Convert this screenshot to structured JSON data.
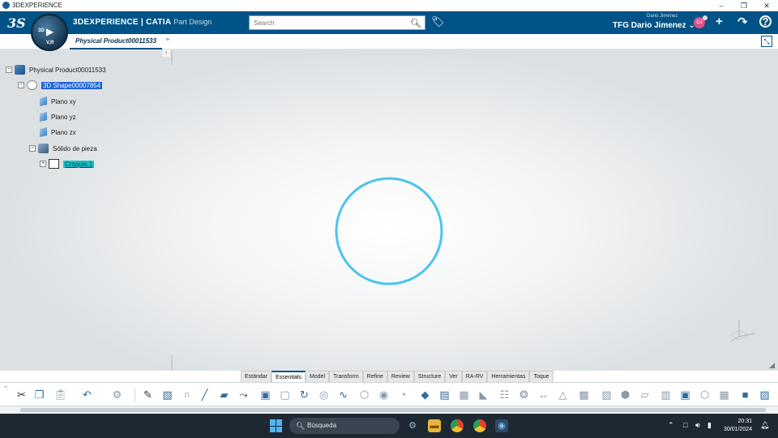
{
  "window": {
    "title": "3DEXPERIENCE",
    "minimize": "–",
    "restore": "❐",
    "close": "✕"
  },
  "header": {
    "logo": "3S",
    "compass": {
      "label_3d": "3D",
      "label_v": "V,R",
      "play": "▶"
    },
    "brand_main": "3DEXPERIENCE | CATIA",
    "brand_app": "Part Design",
    "search_placeholder": "Search",
    "user_small": "Dario Jiménez",
    "user_name": "TFG Dario Jimenez",
    "avatar_initials": "DJ"
  },
  "tabs": {
    "active_tab": "Physical Product00011533",
    "add": "+"
  },
  "tree": [
    {
      "label": "Physical Product00011533",
      "expander": "−",
      "icon": "product-icon",
      "level": 0,
      "highlight": "none"
    },
    {
      "label": "3D Shape00007854",
      "expander": "−",
      "icon": "shape-icon",
      "level": 1,
      "highlight": "blue"
    },
    {
      "label": "Plano xy",
      "expander": "",
      "icon": "plane-icon",
      "level": 2,
      "highlight": "none"
    },
    {
      "label": "Plano yz",
      "expander": "",
      "icon": "plane-icon",
      "level": 2,
      "highlight": "none"
    },
    {
      "label": "Plano zx",
      "expander": "",
      "icon": "plane-icon",
      "level": 2,
      "highlight": "none"
    },
    {
      "label": "Sólido de pieza",
      "expander": "−",
      "icon": "solid-icon",
      "level": 2,
      "highlight": "none"
    },
    {
      "label": "Croquis.1",
      "expander": "+",
      "icon": "sketch-icon",
      "level": 3,
      "highlight": "cyan"
    }
  ],
  "sketch": {
    "color": "#4cc4ec"
  },
  "workbench_tabs": [
    {
      "label": "Estándar",
      "active": false
    },
    {
      "label": "Essentials",
      "active": true
    },
    {
      "label": "Model",
      "active": false
    },
    {
      "label": "Transform",
      "active": false
    },
    {
      "label": "Refine",
      "active": false
    },
    {
      "label": "Review",
      "active": false
    },
    {
      "label": "Structure",
      "active": false
    },
    {
      "label": "Ver",
      "active": false
    },
    {
      "label": "RA-RV",
      "active": false
    },
    {
      "label": "Herramientas",
      "active": false
    },
    {
      "label": "Toque",
      "active": false
    }
  ],
  "taskbar": {
    "search_label": "Búsqueda",
    "time": "20:31",
    "date": "30/01/2024"
  },
  "colors": {
    "header_bg": "#005386",
    "taskbar_bg": "#1e2833",
    "accent": "#005386"
  }
}
